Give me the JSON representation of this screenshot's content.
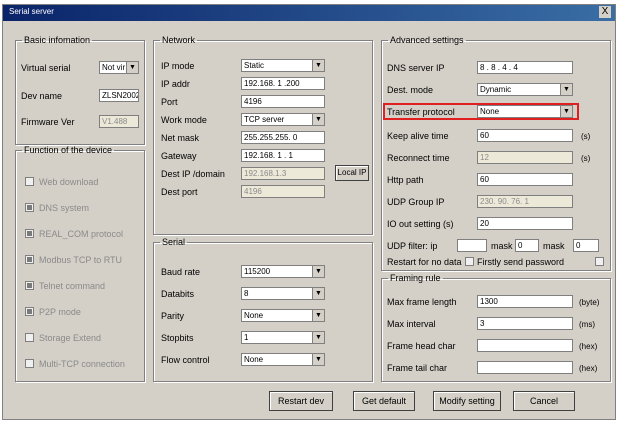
{
  "window": {
    "title": "Serial server",
    "close": "X"
  },
  "basic": {
    "legend": "Basic infomation",
    "virtual_serial_label": "Virtual serial",
    "virtual_serial_value": "Not vir",
    "dev_name_label": "Dev name",
    "dev_name_value": "ZLSN2002",
    "firmware_label": "Firmware Ver",
    "firmware_value": "V1.488"
  },
  "function": {
    "legend": "Function of the device",
    "items": [
      {
        "label": "Web download",
        "checked": false
      },
      {
        "label": "DNS system",
        "checked": true
      },
      {
        "label": "REAL_COM protocol",
        "checked": true
      },
      {
        "label": "Modbus TCP to RTU",
        "checked": true
      },
      {
        "label": "Telnet command",
        "checked": true
      },
      {
        "label": "P2P mode",
        "checked": true
      },
      {
        "label": "Storage Extend",
        "checked": false
      },
      {
        "label": "Multi-TCP connection",
        "checked": false
      }
    ]
  },
  "network": {
    "legend": "Network",
    "ip_mode_label": "IP mode",
    "ip_mode_value": "Static",
    "ip_addr_label": "IP addr",
    "ip_addr_value": "192.168. 1 .200",
    "port_label": "Port",
    "port_value": "4196",
    "work_mode_label": "Work mode",
    "work_mode_value": "TCP server",
    "net_mask_label": "Net mask",
    "net_mask_value": "255.255.255. 0",
    "gateway_label": "Gateway",
    "gateway_value": "192.168. 1 . 1",
    "dest_ip_label": "Dest IP /domain",
    "dest_ip_value": "192.168.1.3",
    "dest_port_label": "Dest port",
    "dest_port_value": "4196",
    "local_button": "Local IP"
  },
  "serial": {
    "legend": "Serial",
    "baud_label": "Baud rate",
    "baud_value": "115200",
    "databits_label": "Databits",
    "databits_value": "8",
    "parity_label": "Parity",
    "parity_value": "None",
    "stopbits_label": "Stopbits",
    "stopbits_value": "1",
    "flow_label": "Flow control",
    "flow_value": "None"
  },
  "advanced": {
    "legend": "Advanced settings",
    "dns_label": "DNS server IP",
    "dns_value": "8 . 8 . 4 . 4",
    "dest_mode_label": "Dest. mode",
    "dest_mode_value": "Dynamic",
    "transfer_label": "Transfer protocol",
    "transfer_value": "None",
    "keep_alive_label": "Keep alive time",
    "keep_alive_value": "60",
    "keep_alive_unit": "(s)",
    "reconnect_label": "Reconnect time",
    "reconnect_value": "12",
    "reconnect_unit": "(s)",
    "http_label": "Http path",
    "http_value": "60",
    "udp_group_label": "UDP Group IP",
    "udp_group_value": "230. 90. 76. 1",
    "io_label": "IO out setting (s)",
    "io_value": "20",
    "udp_filter_label": "UDP filter: ip",
    "udp_filter_ip": "",
    "udp_filter_mask_label": "mask",
    "udp_filter_mask": "0",
    "udp_filter_mask2": "0",
    "reset_label": "Restart for no data",
    "every_label": "Firstly send password"
  },
  "framing": {
    "legend": "Framing rule",
    "max_len_label": "Max frame length",
    "max_len_value": "1300",
    "max_len_unit": "(byte)",
    "max_interval_label": "Max interval",
    "max_interval_value": "3",
    "max_interval_unit": "(ms)",
    "frame_head_label": "Frame head char",
    "frame_head_unit": "(hex)",
    "frame_tail_label": "Frame tail char",
    "frame_tail_unit": "(hex)"
  },
  "buttons": {
    "restart": "Restart dev",
    "get_default": "Get default",
    "modify": "Modify setting",
    "cancel": "Cancel"
  }
}
